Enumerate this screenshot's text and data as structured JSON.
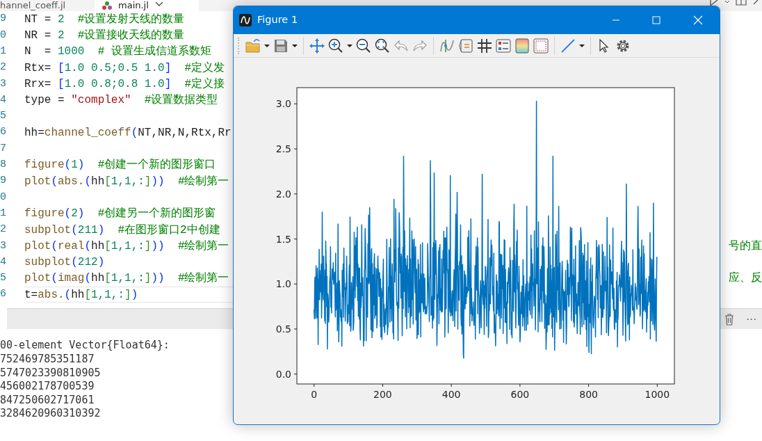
{
  "editor": {
    "tabs": [
      {
        "label": "hannel_coeff.jl",
        "selected": false
      },
      {
        "label": "main.jl",
        "selected": true
      }
    ],
    "code_lines": [
      {
        "number": "9",
        "current": false,
        "tokens": [
          {
            "kind": "plain",
            "text": "NT = "
          },
          {
            "kind": "number",
            "text": "2"
          },
          {
            "kind": "comment",
            "text": "#设置发射天线的数量"
          }
        ]
      },
      {
        "number": "0",
        "current": false,
        "tokens": [
          {
            "kind": "plain",
            "text": "NR = "
          },
          {
            "kind": "number",
            "text": "2"
          },
          {
            "kind": "comment",
            "text": "#设置接收天线的数量"
          }
        ]
      },
      {
        "number": "1",
        "current": false,
        "tokens": [
          {
            "kind": "plain",
            "text": "N  = "
          },
          {
            "kind": "number",
            "text": "1000"
          },
          {
            "kind": "comment",
            "text": "# 设置生成信道系数矩"
          }
        ]
      },
      {
        "number": "2",
        "current": false,
        "tokens": [
          {
            "kind": "plain",
            "text": "Rtx= "
          },
          {
            "kind": "paren",
            "text": "["
          },
          {
            "kind": "number",
            "text": "1.0 0.5;0.5 1.0"
          },
          {
            "kind": "paren",
            "text": "]"
          },
          {
            "kind": "comment",
            "text": "#定义发"
          }
        ]
      },
      {
        "number": "3",
        "current": false,
        "tokens": [
          {
            "kind": "plain",
            "text": "Rrx= "
          },
          {
            "kind": "paren",
            "text": "["
          },
          {
            "kind": "number",
            "text": "1.0 0.8;0.8 1.0"
          },
          {
            "kind": "paren",
            "text": "]"
          },
          {
            "kind": "comment",
            "text": "#定义接"
          }
        ]
      },
      {
        "number": "4",
        "current": false,
        "tokens": [
          {
            "kind": "plain",
            "text": "type = "
          },
          {
            "kind": "string",
            "text": "\"complex\""
          },
          {
            "kind": "comment",
            "text": "#设置数据类型"
          }
        ]
      },
      {
        "number": "5",
        "current": false
      },
      {
        "number": "6",
        "current": false,
        "tokens": [
          {
            "kind": "plain",
            "text": "hh="
          },
          {
            "kind": "function",
            "text": "channel_coeff"
          },
          {
            "kind": "paren",
            "text": "("
          },
          {
            "kind": "plain",
            "text": "NT,NR,N,Rtx,Rr"
          }
        ]
      },
      {
        "number": "7",
        "current": false
      },
      {
        "number": "8",
        "current": false,
        "tokens": [
          {
            "kind": "function",
            "text": "figure"
          },
          {
            "kind": "paren",
            "text": "("
          },
          {
            "kind": "number",
            "text": "1"
          },
          {
            "kind": "paren",
            "text": ")"
          },
          {
            "kind": "comment",
            "text": "#创建一个新的图形窗口"
          }
        ]
      },
      {
        "number": "9",
        "current": false,
        "tokens": [
          {
            "kind": "function",
            "text": "plot"
          },
          {
            "kind": "paren",
            "text": "("
          },
          {
            "kind": "function",
            "text": "abs."
          },
          {
            "kind": "paren",
            "text": "("
          },
          {
            "kind": "plain",
            "text": "hh"
          },
          {
            "kind": "bracket",
            "text": "["
          },
          {
            "kind": "number",
            "text": "1,1,:"
          },
          {
            "kind": "bracket",
            "text": "]"
          },
          {
            "kind": "paren",
            "text": "))"
          },
          {
            "kind": "comment",
            "text": "#绘制第一"
          }
        ]
      },
      {
        "number": "0",
        "current": false
      },
      {
        "number": "1",
        "current": false,
        "tokens": [
          {
            "kind": "function",
            "text": "figure"
          },
          {
            "kind": "paren",
            "text": "("
          },
          {
            "kind": "number",
            "text": "2"
          },
          {
            "kind": "paren",
            "text": ")"
          },
          {
            "kind": "comment",
            "text": "#创建另一个新的图形窗"
          }
        ]
      },
      {
        "number": "2",
        "current": false,
        "tokens": [
          {
            "kind": "function",
            "text": "subplot"
          },
          {
            "kind": "paren",
            "text": "("
          },
          {
            "kind": "number",
            "text": "211"
          },
          {
            "kind": "paren",
            "text": ")"
          },
          {
            "kind": "comment",
            "text": "#在图形窗口2中创建"
          }
        ]
      },
      {
        "number": "3",
        "current": false,
        "tokens": [
          {
            "kind": "function",
            "text": "plot"
          },
          {
            "kind": "paren",
            "text": "("
          },
          {
            "kind": "function",
            "text": "real"
          },
          {
            "kind": "paren",
            "text": "("
          },
          {
            "kind": "plain",
            "text": "hh"
          },
          {
            "kind": "bracket",
            "text": "["
          },
          {
            "kind": "number",
            "text": "1,1,:"
          },
          {
            "kind": "bracket",
            "text": "]"
          },
          {
            "kind": "paren",
            "text": "))"
          },
          {
            "kind": "comment",
            "text": "#绘制第一"
          }
        ],
        "tail": {
          "kind": "comment",
          "text": "号的直"
        }
      },
      {
        "number": "4",
        "current": false,
        "tokens": [
          {
            "kind": "function",
            "text": "subplot"
          },
          {
            "kind": "paren",
            "text": "("
          },
          {
            "kind": "number",
            "text": "212"
          },
          {
            "kind": "paren",
            "text": ")"
          }
        ]
      },
      {
        "number": "5",
        "current": false,
        "tokens": [
          {
            "kind": "function",
            "text": "plot"
          },
          {
            "kind": "paren",
            "text": "("
          },
          {
            "kind": "function",
            "text": "imag"
          },
          {
            "kind": "paren",
            "text": "("
          },
          {
            "kind": "plain",
            "text": "hh"
          },
          {
            "kind": "bracket",
            "text": "["
          },
          {
            "kind": "number",
            "text": "1,1,:"
          },
          {
            "kind": "bracket",
            "text": "]"
          },
          {
            "kind": "paren",
            "text": "))"
          },
          {
            "kind": "comment",
            "text": "#绘制第一"
          }
        ],
        "tail": {
          "kind": "comment",
          "text": "应、反"
        }
      },
      {
        "number": "6",
        "current": true,
        "tokens": [
          {
            "kind": "plain",
            "text": "t="
          },
          {
            "kind": "function",
            "text": "abs."
          },
          {
            "kind": "paren",
            "text": "("
          },
          {
            "kind": "plain",
            "text": "hh"
          },
          {
            "kind": "bracket",
            "text": "["
          },
          {
            "kind": "number",
            "text": "1,1,:"
          },
          {
            "kind": "bracket",
            "text": "]"
          },
          {
            "kind": "paren",
            "text": ")"
          }
        ]
      }
    ]
  },
  "output": {
    "more": "⋯",
    "lines": [
      "00-element Vector{Float64}:",
      "752469785351187",
      "5747023390810905",
      "456002178700539",
      "847250602717061",
      "3284620960310392"
    ]
  },
  "figure_window": {
    "title": "Figure 1",
    "chart_data": {
      "type": "line",
      "xlim": [
        -50,
        1050
      ],
      "ylim": [
        -0.11,
        3.18
      ],
      "xticks": [
        0,
        200,
        400,
        600,
        800,
        1000
      ],
      "yticks": [
        {
          "value": 0,
          "label": "0.0"
        },
        {
          "value": 0.5,
          "label": "0.5"
        },
        {
          "value": 1,
          "label": "1.0"
        },
        {
          "value": 1.5,
          "label": "1.5"
        },
        {
          "value": 2,
          "label": "2.0"
        },
        {
          "value": 2.5,
          "label": "2.5"
        },
        {
          "value": 3,
          "label": "3.0"
        }
      ]
    }
  }
}
